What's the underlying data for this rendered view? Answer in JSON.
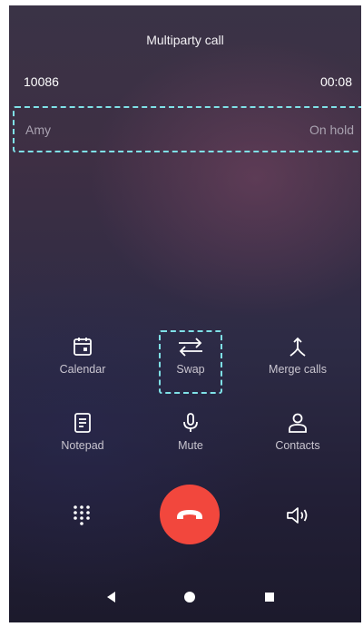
{
  "header": {
    "title": "Multiparty call"
  },
  "active_call": {
    "number": "10086",
    "duration": "00:08"
  },
  "held_call": {
    "name": "Amy",
    "status": "On hold"
  },
  "actions": [
    {
      "label": "Calendar",
      "icon": "calendar-icon"
    },
    {
      "label": "Swap",
      "icon": "swap-icon"
    },
    {
      "label": "Merge calls",
      "icon": "merge-icon"
    },
    {
      "label": "Notepad",
      "icon": "notepad-icon"
    },
    {
      "label": "Mute",
      "icon": "microphone-icon"
    },
    {
      "label": "Contacts",
      "icon": "contacts-icon"
    }
  ],
  "controls": {
    "dialpad_icon": "dialpad-icon",
    "end_call_icon": "phone-hangup-icon",
    "speaker_icon": "speaker-icon",
    "end_call_color": "#f2473d"
  },
  "highlight_color": "#7fe1e7",
  "nav": {
    "back_icon": "back-icon",
    "home_icon": "home-icon",
    "recents_icon": "recents-icon"
  }
}
